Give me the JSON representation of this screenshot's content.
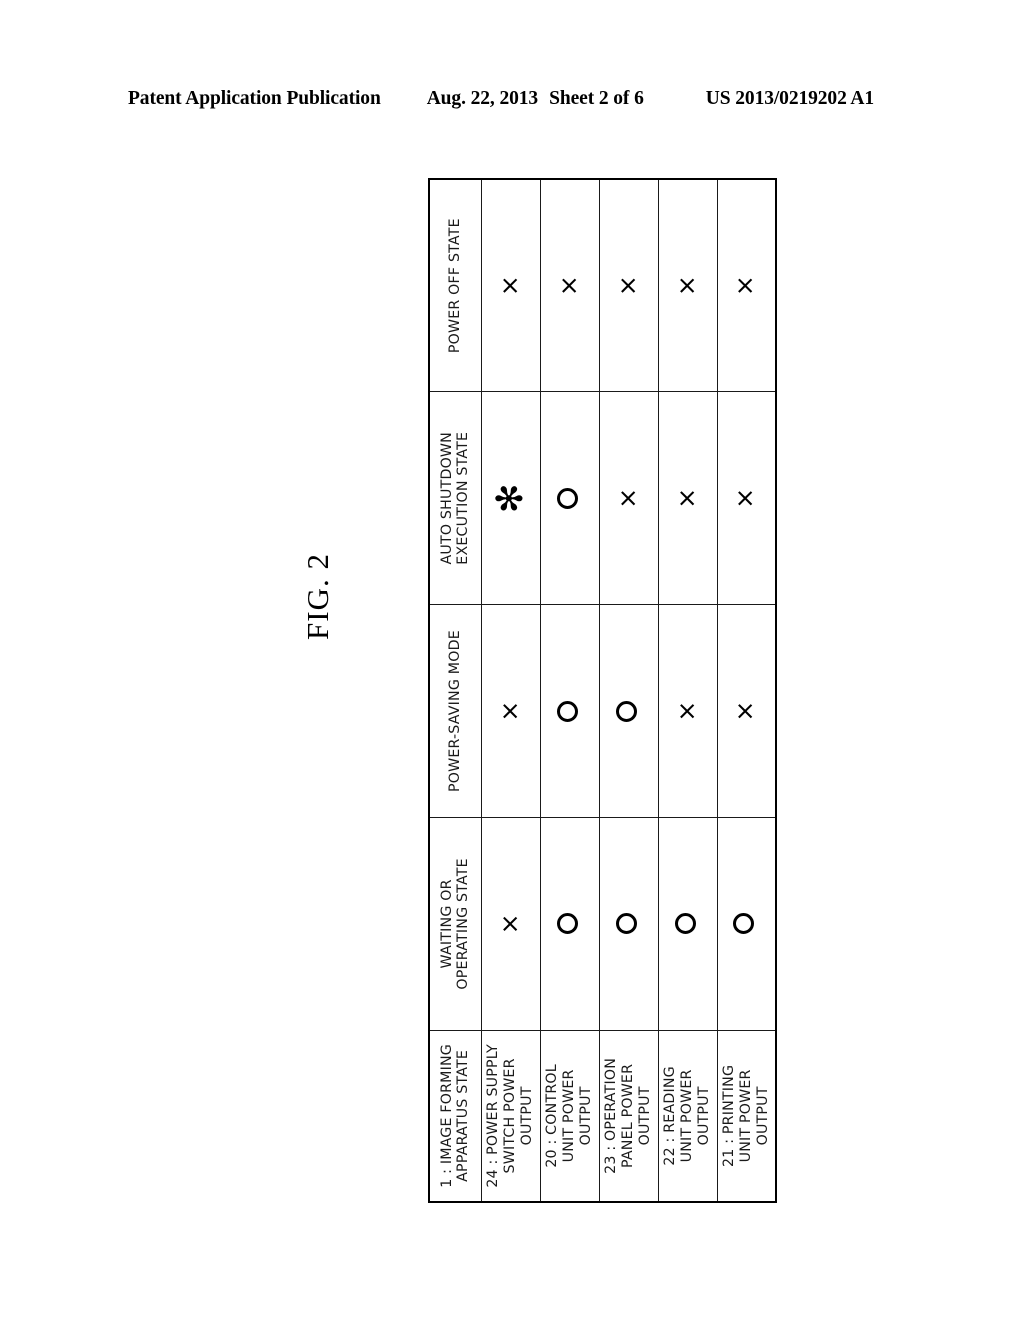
{
  "header": {
    "publication": "Patent Application Publication",
    "date": "Aug. 22, 2013",
    "sheet": "Sheet 2 of 6",
    "patent_number": "US 2013/0219202 A1"
  },
  "figure": {
    "caption": "FIG. 2"
  },
  "table": {
    "row_header_label": "1 : IMAGE FORMING\nAPPARATUS STATE",
    "column_headers": [
      "21 : PRINTING\nUNIT POWER\nOUTPUT",
      "22 : READING\nUNIT POWER\nOUTPUT",
      "23 : OPERATION\nPANEL POWER\nOUTPUT",
      "20 : CONTROL\nUNIT POWER\nOUTPUT",
      "24 : POWER SUPPLY\nSWITCH POWER\nOUTPUT"
    ],
    "row_labels": [
      "WAITING OR\nOPERATING STATE",
      "POWER-SAVING MODE",
      "AUTO SHUTDOWN\nEXECUTION STATE",
      "POWER OFF STATE"
    ],
    "symbols": {
      "circle": "circle",
      "cross": "×",
      "asterisk": "✻"
    },
    "rows": [
      {
        "label": "WAITING OR\nOPERATING STATE",
        "values": [
          "circle",
          "circle",
          "circle",
          "circle",
          "cross"
        ]
      },
      {
        "label": "POWER-SAVING MODE",
        "values": [
          "cross",
          "cross",
          "circle",
          "circle",
          "cross"
        ]
      },
      {
        "label": "AUTO SHUTDOWN\nEXECUTION STATE",
        "values": [
          "cross",
          "cross",
          "cross",
          "circle",
          "asterisk"
        ]
      },
      {
        "label": "POWER OFF STATE",
        "values": [
          "cross",
          "cross",
          "cross",
          "cross",
          "cross"
        ]
      }
    ]
  },
  "colors": {
    "ink": "#000000",
    "grid": "#1a1a1a",
    "grid_light": "#b4b4b4",
    "background": "#ffffff"
  }
}
